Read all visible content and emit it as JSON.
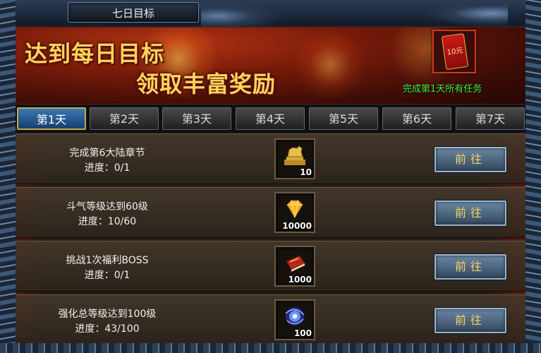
{
  "window": {
    "title": "七日目标"
  },
  "banner": {
    "line1": "达到每日目标",
    "line2": "领取丰富奖励",
    "reward_packet_value": "10元",
    "complete_all_text": "完成第1天所有任务"
  },
  "tabs": [
    {
      "label": "第1天",
      "active": true
    },
    {
      "label": "第2天",
      "active": false
    },
    {
      "label": "第3天",
      "active": false
    },
    {
      "label": "第4天",
      "active": false
    },
    {
      "label": "第5天",
      "active": false
    },
    {
      "label": "第6天",
      "active": false
    },
    {
      "label": "第7天",
      "active": false
    }
  ],
  "tasks": [
    {
      "name": "完成第6大陆章节",
      "progress": "进度：0/1",
      "reward_icon": "golden-lion-statue-icon",
      "reward_count": "10",
      "button": "前往"
    },
    {
      "name": "斗气等级达到60级",
      "progress": "进度：10/60",
      "reward_icon": "gold-diamond-icon",
      "reward_count": "10000",
      "button": "前往"
    },
    {
      "name": "挑战1次福利BOSS",
      "progress": "进度：0/1",
      "reward_icon": "red-book-icon",
      "reward_count": "1000",
      "button": "前往"
    },
    {
      "name": "强化总等级达到100级",
      "progress": "进度：43/100",
      "reward_icon": "blue-vortex-orb-icon",
      "reward_count": "100",
      "button": "前往"
    }
  ],
  "colors": {
    "accent_gold": "#f4d35a",
    "complete_green": "#3ef03e",
    "active_tab": "#2c64a0"
  }
}
